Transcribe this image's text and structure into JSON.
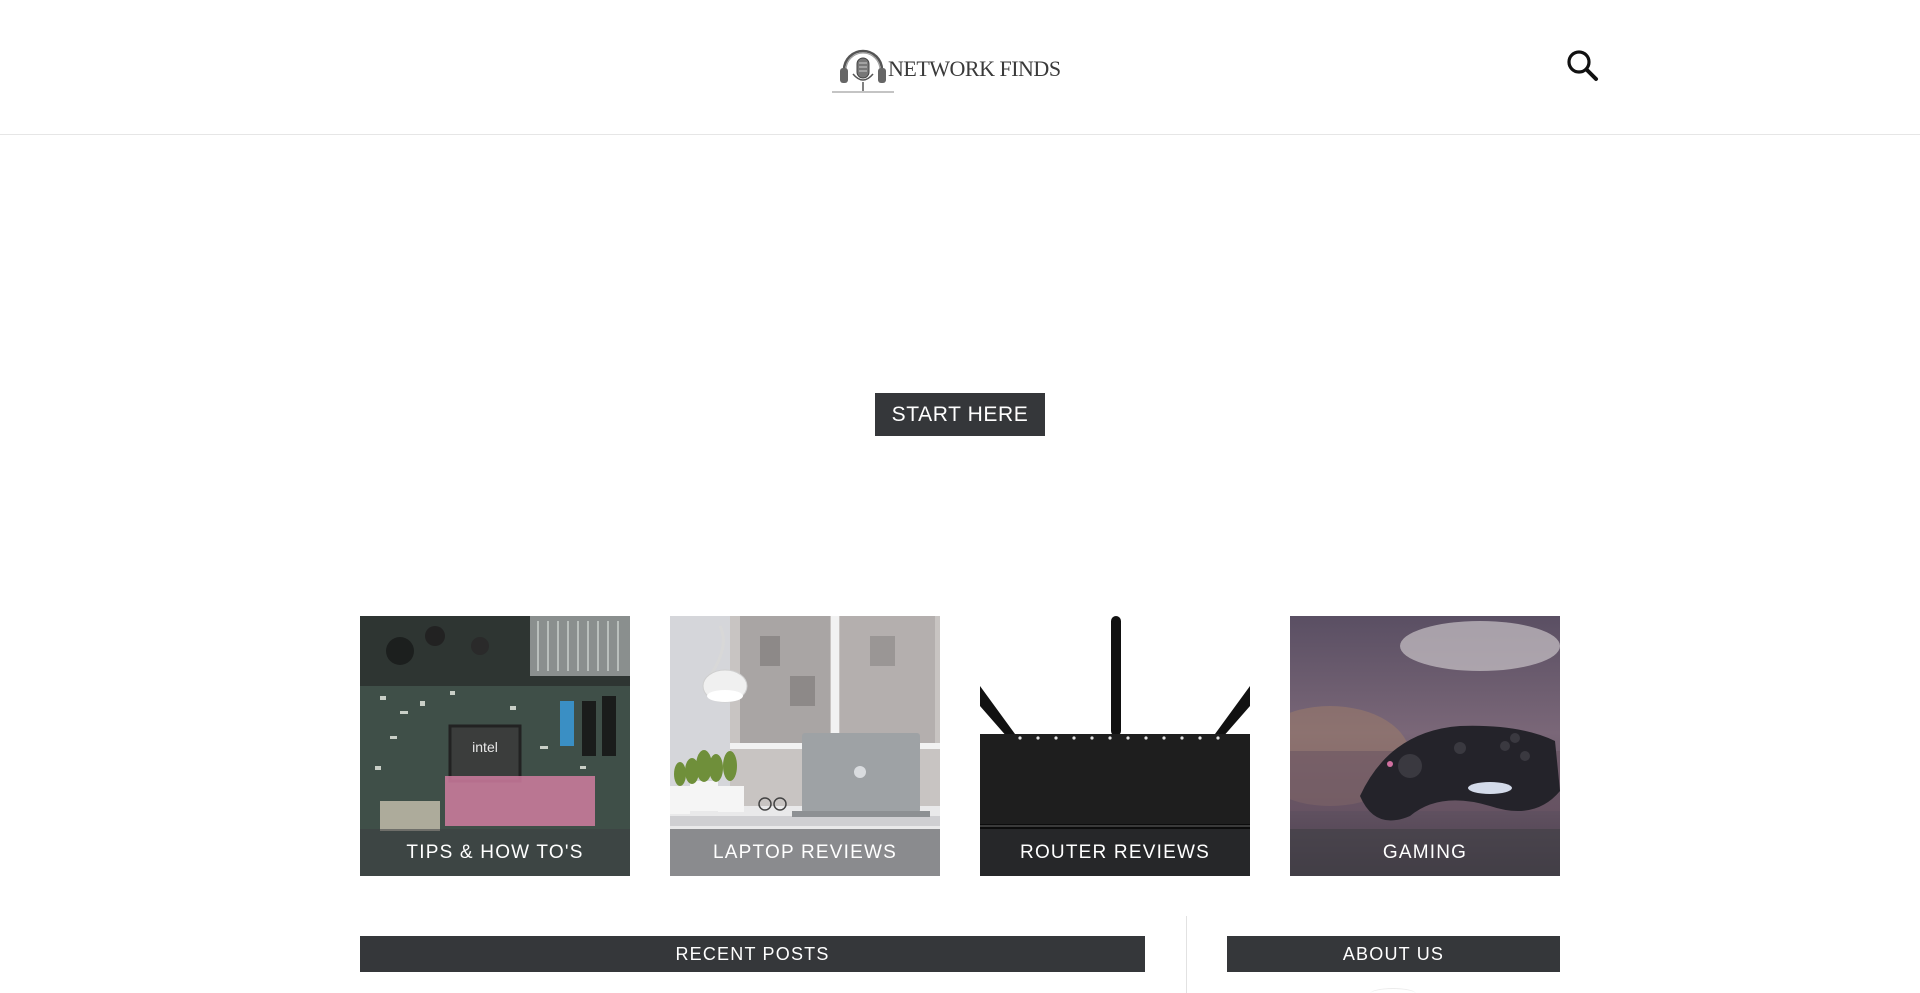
{
  "header": {
    "logo_text": "NETWORK FINDS",
    "logo_icon": "headphones-microphone-logo",
    "search_icon": "search-icon"
  },
  "hero": {
    "cta_label": "START HERE"
  },
  "categories": [
    {
      "label": "TIPS & HOW TO'S",
      "image": "motherboard-intel-chip-photo"
    },
    {
      "label": "LAPTOP REVIEWS",
      "image": "laptop-on-desk-photo"
    },
    {
      "label": "ROUTER REVIEWS",
      "image": "router-antennas-photo"
    },
    {
      "label": "GAMING",
      "image": "game-controller-photo"
    }
  ],
  "sections": {
    "recent_posts_title": "RECENT POSTS",
    "about_us_title": "ABOUT US"
  },
  "colors": {
    "dark_bar": "#35373a",
    "label_overlay": "rgba(60,62,66,0.55)",
    "page_bg": "#ffffff"
  }
}
